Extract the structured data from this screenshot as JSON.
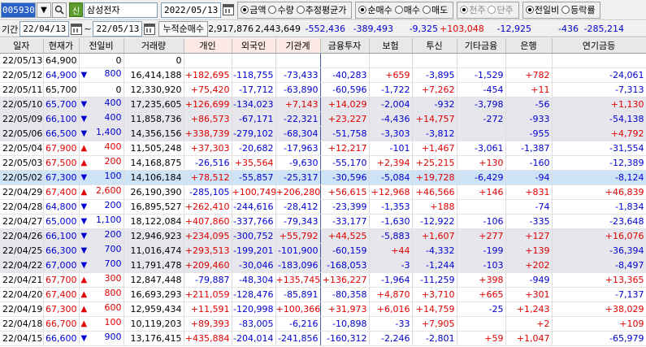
{
  "toolbar": {
    "stock_code": "005930",
    "sin_label": "신",
    "stock_name": "삼성전자",
    "date": "2022/05/13",
    "unit_options": [
      {
        "label": "금액",
        "checked": true
      },
      {
        "label": "수량",
        "checked": false
      },
      {
        "label": "추정평균가",
        "checked": false
      }
    ],
    "trade_options": [
      {
        "label": "순매수",
        "checked": true
      },
      {
        "label": "매수",
        "checked": false
      },
      {
        "label": "매도",
        "checked": false
      }
    ],
    "unit2_options": [
      {
        "label": "천주",
        "checked": true,
        "disabled": true
      },
      {
        "label": "단주",
        "checked": false,
        "disabled": true
      }
    ],
    "compare_options": [
      {
        "label": "전일비",
        "checked": true
      },
      {
        "label": "등락률",
        "checked": false
      }
    ]
  },
  "period": {
    "label": "기간",
    "start": "22/04/13",
    "end": "22/05/13",
    "sum_label": "누적순매수",
    "sums": [
      "2,917,876",
      "2,443,649",
      "-552,436",
      "-389,493",
      "-9,325",
      "+103,048",
      "-12,925",
      "-436",
      "-285,214"
    ]
  },
  "columns": [
    "일자",
    "현재가",
    "전일비",
    "거래량",
    "개인",
    "외국인",
    "기관계",
    "금융투자",
    "보험",
    "투신",
    "기타금융",
    "은행",
    "연기금등"
  ],
  "rows": [
    {
      "date": "22/05/13",
      "price": "64,900",
      "dir": "",
      "change": "0",
      "volume": "0",
      "vals": [
        "",
        "",
        "",
        "",
        "",
        "",
        "",
        "",
        ""
      ],
      "style": ""
    },
    {
      "date": "22/05/12",
      "price": "64,900",
      "dir": "down",
      "change": "800",
      "volume": "16,414,188",
      "vals": [
        "+182,695",
        "-118,755",
        "-73,433",
        "-40,283",
        "+659",
        "-3,895",
        "-1,529",
        "+782",
        "-24,061"
      ],
      "style": ""
    },
    {
      "date": "22/05/11",
      "price": "65,700",
      "dir": "",
      "change": "0",
      "volume": "12,330,920",
      "vals": [
        "+75,420",
        "-17,712",
        "-63,890",
        "-60,596",
        "-1,722",
        "+7,262",
        "-454",
        "+11",
        "-7,313"
      ],
      "style": ""
    },
    {
      "date": "22/05/10",
      "price": "65,700",
      "dir": "down",
      "change": "400",
      "volume": "17,235,605",
      "vals": [
        "+126,699",
        "-134,023",
        "+7,143",
        "+14,029",
        "-2,004",
        "-932",
        "-3,798",
        "-56",
        "+1,130"
      ],
      "style": "gray"
    },
    {
      "date": "22/05/09",
      "price": "66,100",
      "dir": "down",
      "change": "400",
      "volume": "11,858,736",
      "vals": [
        "+86,573",
        "-67,171",
        "-22,321",
        "+23,227",
        "-4,436",
        "+14,757",
        "-272",
        "-933",
        "-54,138"
      ],
      "style": "gray"
    },
    {
      "date": "22/05/06",
      "price": "66,500",
      "dir": "down",
      "change": "1,400",
      "volume": "14,356,156",
      "vals": [
        "+338,739",
        "-279,102",
        "-68,304",
        "-51,758",
        "-3,303",
        "-3,812",
        "",
        "-955",
        "+4,792"
      ],
      "style": "gray"
    },
    {
      "date": "22/05/04",
      "price": "67,900",
      "dir": "up",
      "change": "400",
      "volume": "11,505,248",
      "vals": [
        "+37,303",
        "-20,682",
        "-17,963",
        "+12,217",
        "-101",
        "+1,467",
        "-3,061",
        "-1,387",
        "-31,554"
      ],
      "style": ""
    },
    {
      "date": "22/05/03",
      "price": "67,500",
      "dir": "up",
      "change": "200",
      "volume": "14,168,875",
      "vals": [
        "-26,516",
        "+35,564",
        "-9,630",
        "-55,170",
        "+2,394",
        "+25,215",
        "+130",
        "-160",
        "-12,389"
      ],
      "style": ""
    },
    {
      "date": "22/05/02",
      "price": "67,300",
      "dir": "down",
      "change": "100",
      "volume": "14,106,184",
      "vals": [
        "+78,512",
        "-55,857",
        "-25,317",
        "-30,596",
        "-5,084",
        "+19,728",
        "-6,429",
        "-94",
        "-8,124"
      ],
      "style": "selected"
    },
    {
      "date": "22/04/29",
      "price": "67,400",
      "dir": "up",
      "change": "2,600",
      "volume": "26,190,390",
      "vals": [
        "-285,105",
        "+100,749",
        "+206,280",
        "+56,615",
        "+12,968",
        "+46,566",
        "+146",
        "+831",
        "+46,839"
      ],
      "style": ""
    },
    {
      "date": "22/04/28",
      "price": "64,800",
      "dir": "down",
      "change": "200",
      "volume": "16,895,527",
      "vals": [
        "+262,410",
        "-244,616",
        "-28,412",
        "-23,399",
        "-1,353",
        "+188",
        "",
        "-74",
        "-1,834"
      ],
      "style": ""
    },
    {
      "date": "22/04/27",
      "price": "65,000",
      "dir": "down",
      "change": "1,100",
      "volume": "18,122,084",
      "vals": [
        "+407,860",
        "-337,766",
        "-79,343",
        "-33,177",
        "-1,630",
        "-12,922",
        "-106",
        "-335",
        "-23,648"
      ],
      "style": ""
    },
    {
      "date": "22/04/26",
      "price": "66,100",
      "dir": "down",
      "change": "200",
      "volume": "12,946,923",
      "vals": [
        "+234,095",
        "-300,752",
        "+55,792",
        "+44,525",
        "-5,883",
        "+1,607",
        "+277",
        "+127",
        "+16,076"
      ],
      "style": "gray"
    },
    {
      "date": "22/04/25",
      "price": "66,300",
      "dir": "down",
      "change": "700",
      "volume": "11,016,474",
      "vals": [
        "+293,513",
        "-199,201",
        "-101,900",
        "-60,159",
        "+44",
        "-4,332",
        "-199",
        "+139",
        "-36,394"
      ],
      "style": "gray"
    },
    {
      "date": "22/04/22",
      "price": "67,000",
      "dir": "down",
      "change": "700",
      "volume": "11,791,478",
      "vals": [
        "+209,460",
        "-30,046",
        "-183,096",
        "-168,053",
        "-3",
        "-1,244",
        "-103",
        "+202",
        "-8,497"
      ],
      "style": "gray"
    },
    {
      "date": "22/04/21",
      "price": "67,700",
      "dir": "up",
      "change": "300",
      "volume": "12,847,448",
      "vals": [
        "-79,887",
        "-48,304",
        "+135,745",
        "+136,227",
        "-1,964",
        "-11,259",
        "+398",
        "-949",
        "+13,365"
      ],
      "style": ""
    },
    {
      "date": "22/04/20",
      "price": "67,400",
      "dir": "up",
      "change": "800",
      "volume": "16,693,293",
      "vals": [
        "+211,059",
        "-128,476",
        "-85,891",
        "-80,358",
        "+4,870",
        "+3,710",
        "+665",
        "+301",
        "-7,137"
      ],
      "style": ""
    },
    {
      "date": "22/04/19",
      "price": "67,300",
      "dir": "up",
      "change": "600",
      "volume": "12,959,434",
      "vals": [
        "+11,591",
        "-120,998",
        "+100,366",
        "+31,973",
        "+6,016",
        "+14,759",
        "-25",
        "+1,243",
        "+38,029"
      ],
      "style": ""
    },
    {
      "date": "22/04/18",
      "price": "66,700",
      "dir": "up",
      "change": "100",
      "volume": "10,119,203",
      "vals": [
        "+89,393",
        "-83,005",
        "-6,216",
        "-10,898",
        "-33",
        "+7,905",
        "",
        "+2",
        "+109"
      ],
      "style": ""
    },
    {
      "date": "22/04/15",
      "price": "66,600",
      "dir": "down",
      "change": "900",
      "volume": "13,176,415",
      "vals": [
        "+435,884",
        "-204,014",
        "-241,856",
        "-160,312",
        "-2,246",
        "-2,801",
        "+59",
        "+1,047",
        "-65,979"
      ],
      "style": ""
    }
  ],
  "colors": {
    "positive": "#e00000",
    "negative": "#0000d0",
    "code_bg": "#2860c8",
    "selected_row": "#cfe3f7",
    "gray_row": "#e6e6ec"
  }
}
